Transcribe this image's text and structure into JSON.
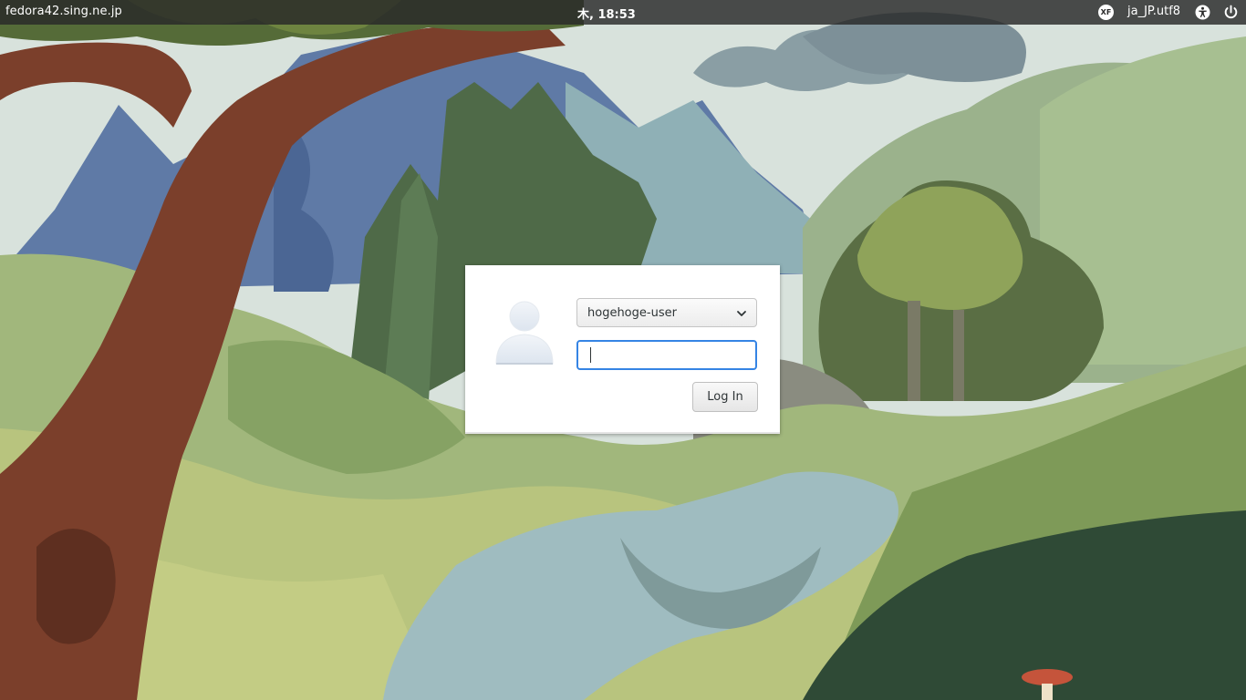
{
  "topbar": {
    "hostname": "fedora42.sing.ne.jp",
    "clock": "木, 18:53",
    "input_method_badge": "XF",
    "locale": "ja_JP.utf8",
    "accessibility_icon": "accessibility-icon",
    "power_icon": "power-icon"
  },
  "login": {
    "avatar_icon": "user-avatar-icon",
    "selected_user": "hogehoge-user",
    "password_value": "",
    "login_label": "Log In"
  },
  "colors": {
    "topbar_bg": "#282828",
    "focus_ring": "#3584e4",
    "dialog_bg": "#ffffff"
  }
}
